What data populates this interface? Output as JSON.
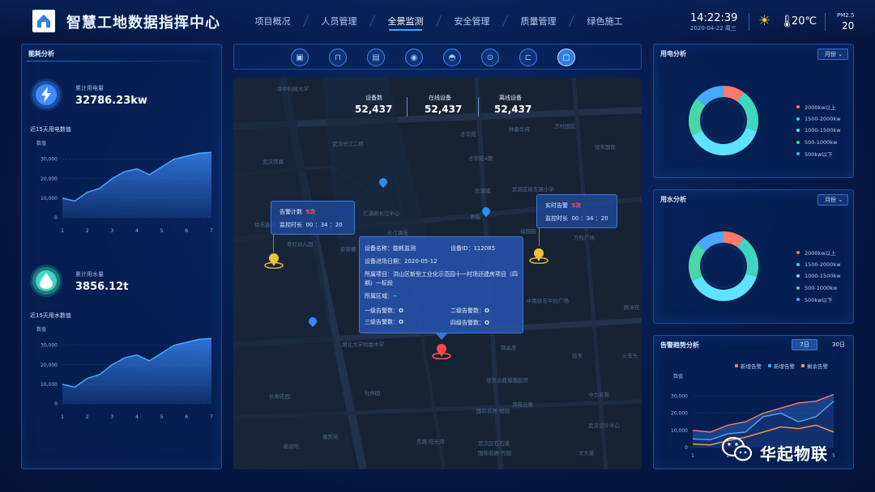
{
  "app": {
    "title": "智慧工地数据指挥中心"
  },
  "nav": {
    "items": [
      {
        "label": "项目概况",
        "active": false
      },
      {
        "label": "人员管理",
        "active": false
      },
      {
        "label": "全景监测",
        "active": true
      },
      {
        "label": "安全管理",
        "active": false
      },
      {
        "label": "质量管理",
        "active": false
      },
      {
        "label": "绿色施工",
        "active": false
      }
    ]
  },
  "header": {
    "time": "14:22:39",
    "date": "2020-04-22 周三",
    "temperature": "20℃",
    "pm_label": "PM2.5",
    "pm_value": "20",
    "weather_icon": "sun-icon",
    "temp_icon": "thermometer-icon"
  },
  "energy": {
    "title": "能耗分析",
    "electric_label": "累计用电量",
    "electric_value": "32786.23kw",
    "electric_chart_title": "近15天用电数值",
    "water_label": "累计用水量",
    "water_value": "3856.12t",
    "water_chart_title": "近15天用水数值",
    "y_axis_label": "数值"
  },
  "toolbar": {
    "icons": [
      "camera-icon",
      "crane-icon",
      "gate-icon",
      "sensor-icon",
      "helmet-icon",
      "location-icon",
      "elevator-icon",
      "monitor-icon"
    ],
    "active_index": 7
  },
  "map": {
    "stats": [
      {
        "label": "设备数",
        "value": "52,437"
      },
      {
        "label": "在线设备",
        "value": "52,437"
      },
      {
        "label": "离线设备",
        "value": "52,437"
      }
    ],
    "alarm_tip": {
      "count_label": "告警计数",
      "count_value": "5次",
      "duration_label": "监控时长",
      "duration_value": "00 ：34 ：20"
    },
    "realtime_tip": {
      "label": "实时告警",
      "value": "5次",
      "duration_label": "监控时长",
      "duration_value": "00 ：34 ：20"
    },
    "device_tip": {
      "name_label": "设备名称：",
      "name": "能耗监测",
      "id_label": "设备ID：",
      "id": "112085",
      "date_label": "设备进场日期：",
      "date": "2020-05-12",
      "project_label": "所属项目：",
      "project": "洪山区新型工业化示范园十一村场还建房项目（四期）一标段",
      "area_label": "所属区域：",
      "area": "--",
      "level1_label": "一级告警数：",
      "level1": "O",
      "level2_label": "二级告警数：",
      "level2": "O",
      "level3_label": "三级告警数：",
      "level3": "O",
      "level4_label": "四级告警数：",
      "level4": "O"
    },
    "labels": [
      "华中科技大学",
      "武汉长江二桥",
      "才华苑",
      "林泰华府",
      "方村园区",
      "徐东国际",
      "才华苑4期",
      "武汉铁路",
      "优涌城",
      "武昌区徐东路小学",
      "汇通新长江中心",
      "君临",
      "长江锦苑",
      "徐家棚",
      "福园园",
      "万科广场",
      "徐东鑫城",
      "育红幼儿园",
      "中南徐东平价广场",
      "欧洲花",
      "湖北大学附属中学",
      "锦晶度",
      "徐东",
      "火车头",
      "徐东古瓶城嘉庭馆",
      "杜仲园",
      "中力名苑",
      "清苑公寓",
      "长寿花园",
      "国际名居·楼园",
      "武汉设计中心",
      "武汉区石石道",
      "新房所",
      "嘉宾苑",
      "东路·阳光湾",
      "国际名居·竹园",
      "文大厦"
    ]
  },
  "electric": {
    "title": "用电分析",
    "select": "月份",
    "legend": [
      "2000kw以上",
      "1500-2000kw",
      "1000-1500kw",
      "500-1000kw",
      "500kw以下"
    ]
  },
  "water": {
    "title": "用水分析",
    "select": "月份",
    "legend": [
      "2000kw以上",
      "1500-2000kw",
      "1000-1500kw",
      "500-1000kw",
      "500kw以下"
    ]
  },
  "alarm": {
    "title": "告警趋势分析",
    "btn_7d": "7日",
    "btn_30d": "30日",
    "legend": [
      "新增告警",
      "新增告警",
      "剩余告警"
    ],
    "y_axis_label": "数值"
  },
  "watermark": {
    "text": "华起物联"
  },
  "colors": {
    "accent": "#2f7fe6",
    "red": "#ff6b6b",
    "teal": "#3ed6c1",
    "cyan": "#5ee3ff",
    "blue": "#4aa8ff",
    "orange": "#ff9a52"
  },
  "chart_data": [
    {
      "type": "area",
      "title": "近15天用电数值",
      "ylabel": "数值",
      "categories": [
        "1",
        "2",
        "3",
        "4",
        "5",
        "6",
        "7"
      ],
      "x": [
        1,
        1.5,
        2,
        2.5,
        3,
        3.5,
        4,
        4.5,
        5,
        5.5,
        6,
        6.5,
        7
      ],
      "values": [
        10000,
        8500,
        13000,
        15000,
        20000,
        23500,
        25000,
        22000,
        26000,
        30000,
        31500,
        33000,
        33500
      ],
      "yticks": [
        "0",
        "10,000",
        "20,000",
        "30,000"
      ],
      "ylim": [
        0,
        34000
      ]
    },
    {
      "type": "area",
      "title": "近15天用水数值",
      "ylabel": "数值",
      "categories": [
        "1",
        "2",
        "3",
        "4",
        "5",
        "6",
        "7"
      ],
      "x": [
        1,
        1.5,
        2,
        2.5,
        3,
        3.5,
        4,
        4.5,
        5,
        5.5,
        6,
        6.5,
        7
      ],
      "values": [
        10000,
        8500,
        13000,
        15000,
        20000,
        23500,
        25000,
        22000,
        26000,
        30000,
        31500,
        33000,
        33500
      ],
      "yticks": [
        "0",
        "10,000",
        "20,000",
        "30,000"
      ],
      "ylim": [
        0,
        34000
      ]
    },
    {
      "type": "pie",
      "title": "用电分析",
      "labels": [
        "2000kw以上",
        "1500-2000kw",
        "1000-1500kw",
        "500-1000kw",
        "500kw以下"
      ],
      "values": [
        10,
        20,
        38,
        18,
        14
      ],
      "colors": [
        "#ff7a6b",
        "#3ed6c1",
        "#5ee3ff",
        "#4ad7a8",
        "#4aa8ff"
      ]
    },
    {
      "type": "pie",
      "title": "用水分析",
      "labels": [
        "2000kw以上",
        "1500-2000kw",
        "1000-1500kw",
        "500-1000kw",
        "500kw以下"
      ],
      "values": [
        10,
        20,
        38,
        18,
        14
      ],
      "colors": [
        "#ff7a6b",
        "#3ed6c1",
        "#5ee3ff",
        "#4ad7a8",
        "#4aa8ff"
      ]
    },
    {
      "type": "line",
      "title": "告警趋势分析",
      "ylabel": "数值",
      "x": [
        1,
        1.5,
        2,
        2.5,
        3,
        3.5,
        4,
        4.5,
        5
      ],
      "series": [
        {
          "name": "新增告警",
          "color": "#ff7a6b",
          "values": [
            10000,
            9000,
            13000,
            15000,
            20000,
            23000,
            26000,
            27000,
            31000
          ]
        },
        {
          "name": "新增告警",
          "color": "#4aa8ff",
          "values": [
            5000,
            4500,
            8000,
            9000,
            18000,
            20000,
            15000,
            18000,
            27000
          ]
        },
        {
          "name": "剩余告警",
          "color": "#ff9a52",
          "values": [
            2000,
            1500,
            4000,
            6000,
            9000,
            12000,
            11000,
            13000,
            9000
          ]
        }
      ],
      "categories": [
        "1",
        "2",
        "3",
        "4",
        "5"
      ],
      "yticks": [
        "0",
        "10,000",
        "20,000",
        "30,000"
      ],
      "ylim": [
        0,
        34000
      ]
    }
  ]
}
